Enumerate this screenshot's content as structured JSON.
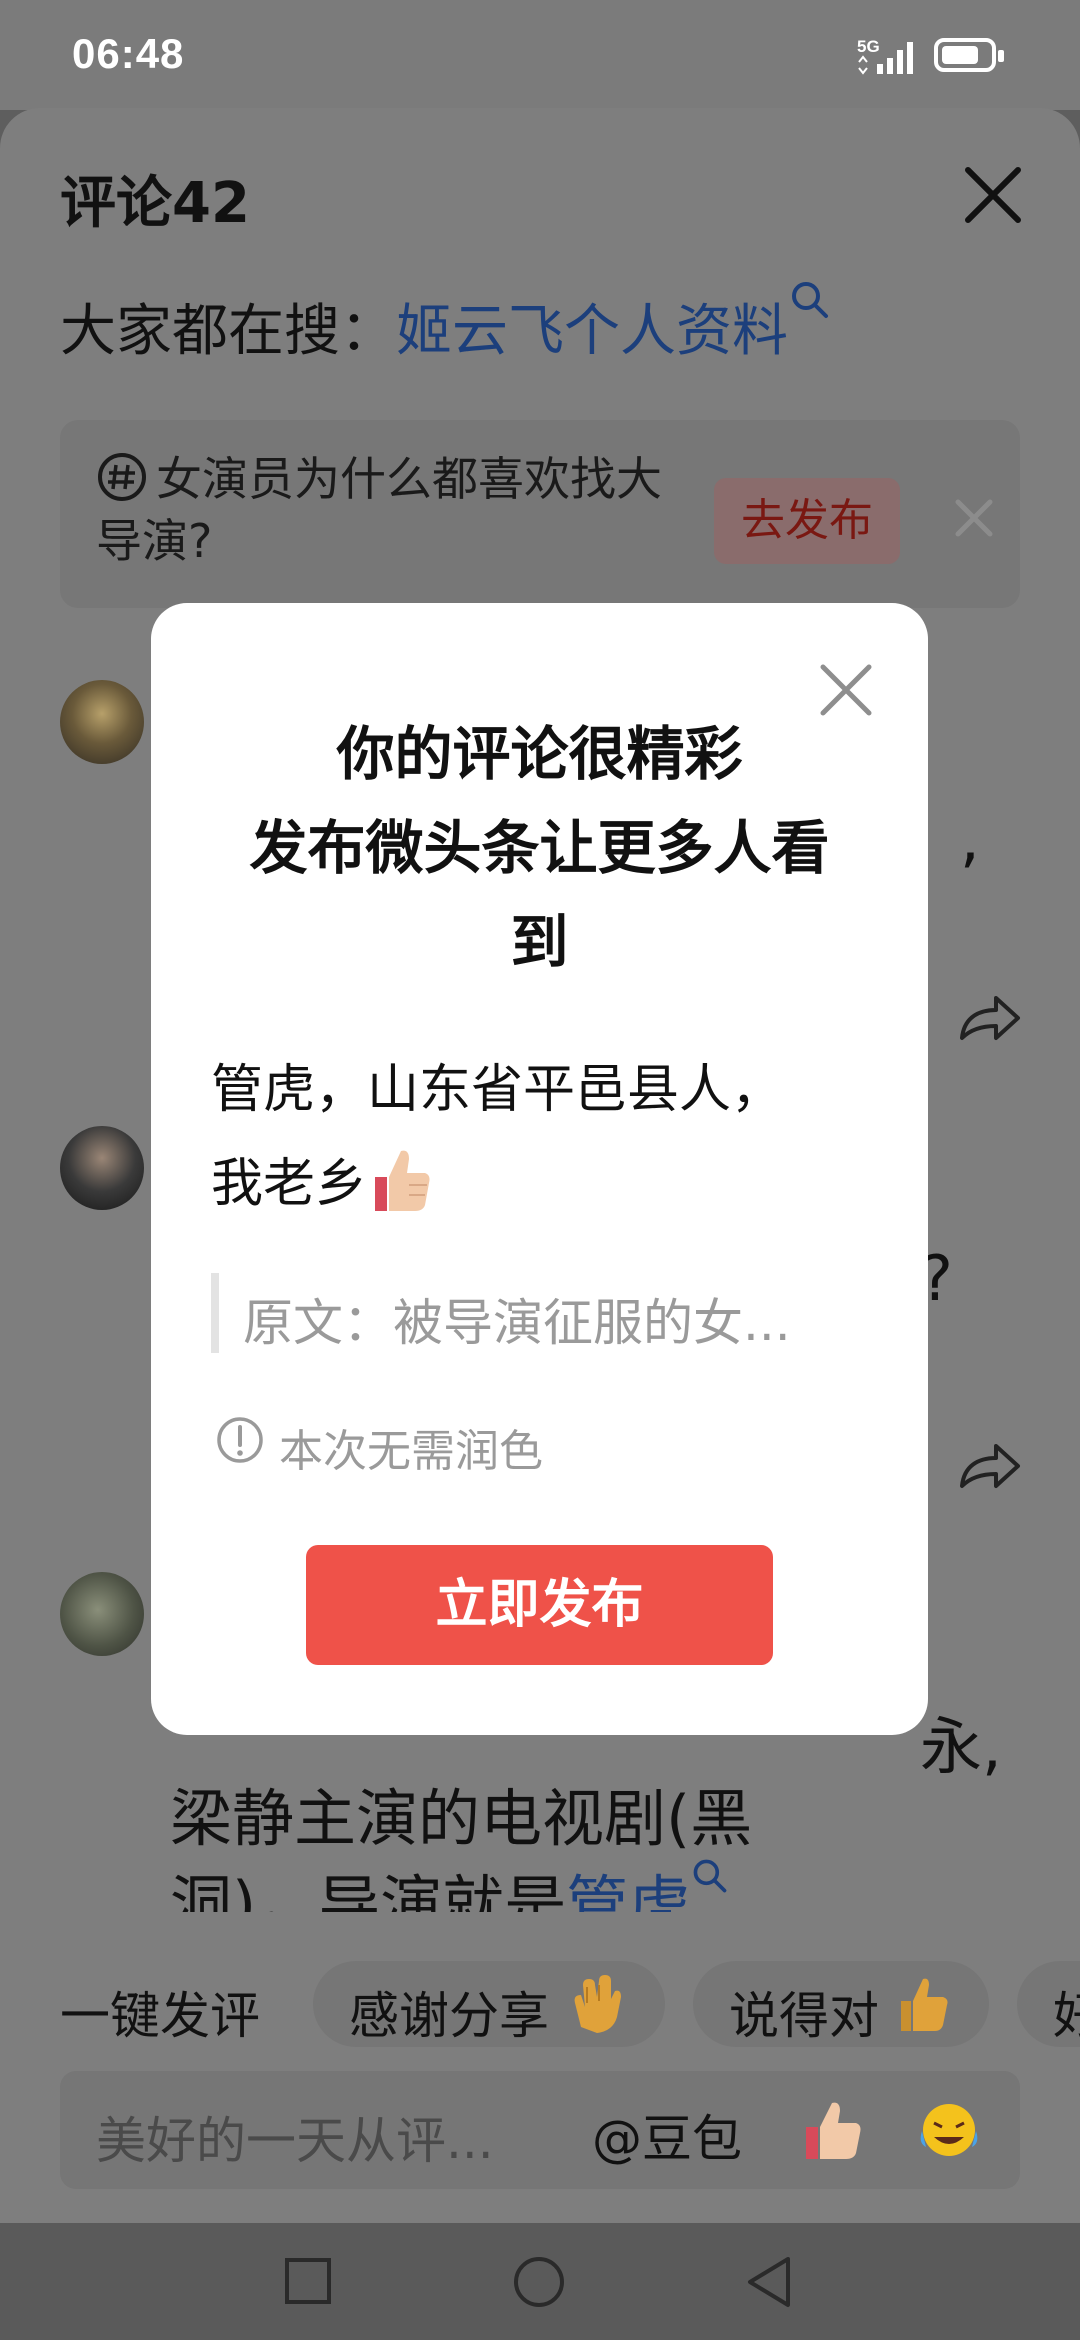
{
  "status_bar": {
    "time": "06:48",
    "network": "5G"
  },
  "comments_sheet": {
    "title": "评论42",
    "search_prefix": "大家都在搜：",
    "search_link": "姬云飞个人资料",
    "topic_text": "女演员为什么都喜欢找大导演?",
    "topic_button": "去发布",
    "bg_fragments": {
      "c1": "、,",
      "c2": "?",
      "c3_line1": "永,",
      "c3_line2": "梁静主演的电视剧(黑",
      "c3_line3_a": "洞)，导演就是",
      "c3_line3_link": "管虎"
    }
  },
  "quick_replies": {
    "label": "一键发评",
    "chips": [
      "感谢分享",
      "说得对",
      "好"
    ]
  },
  "input_bar": {
    "placeholder": "美好的一天从评...",
    "mention": "@豆包"
  },
  "dialog": {
    "title_line1": "你的评论很精彩",
    "title_line2": "发布微头条让更多人看",
    "title_line3": "到",
    "comment_line1": "管虎，山东省平邑县人，",
    "comment_line2": "我老乡",
    "quote": "原文：被导演征服的女...",
    "hint": "本次无需润色",
    "publish_button": "立即发布"
  },
  "colors": {
    "accent": "#ef5249",
    "link": "#1c3f7c",
    "overlay": "#7e7e7e"
  },
  "icons": [
    "signal-icon",
    "battery-icon",
    "close-icon",
    "topic-hashtag-icon",
    "search-icon",
    "share-icon",
    "thumbs-up-emoji",
    "clap-emoji",
    "laughing-emoji",
    "info-icon",
    "nav-recents-icon",
    "nav-home-icon",
    "nav-back-icon"
  ]
}
